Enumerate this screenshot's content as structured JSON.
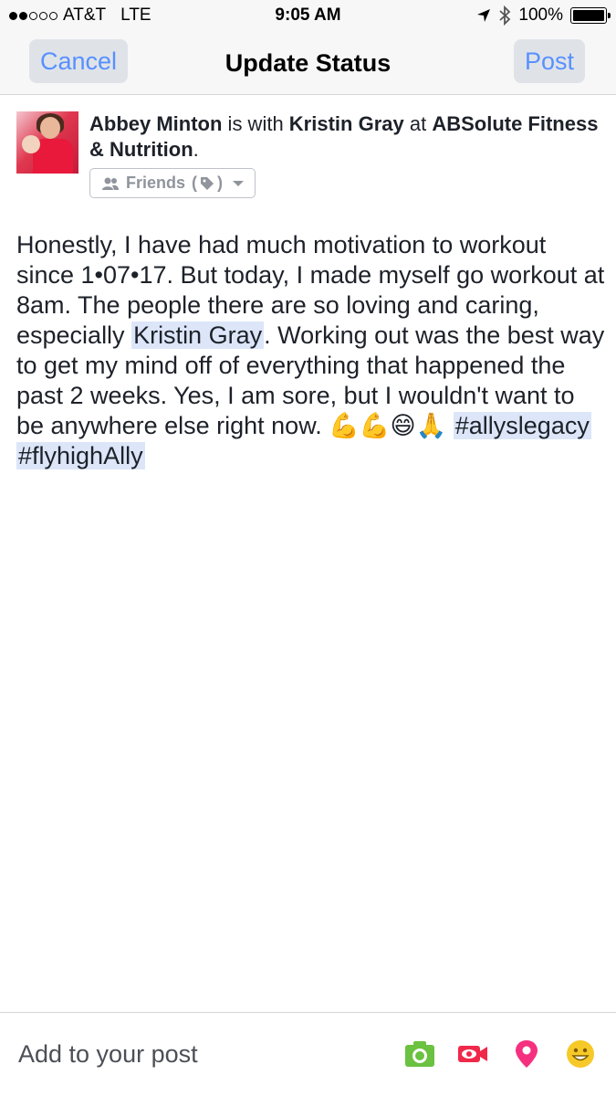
{
  "status_bar": {
    "carrier": "AT&T",
    "network": "LTE",
    "time": "9:05 AM",
    "battery": "100%",
    "signal_bars_filled": 2,
    "signal_bars_total": 5
  },
  "nav": {
    "cancel_label": "Cancel",
    "title": "Update Status",
    "post_label": "Post"
  },
  "header": {
    "author": "Abbey Minton",
    "with_text": " is with ",
    "tagged": "Kristin Gray",
    "at_text": " at ",
    "place": "ABSolute Fitness & Nutrition",
    "end": ".",
    "audience": "Friends",
    "audience_paren_open": "(",
    "audience_paren_close": ")"
  },
  "post": {
    "text_part1": "Honestly, I have had much motivation to workout since 1•07•17. But today, I made myself go workout at 8am. The people there are so loving and caring, especially ",
    "mention": "Kristin Gray",
    "text_part2": ". Working out was the best way to get my mind off of everything that happened the past 2 weeks. Yes, I am sore, but I wouldn't want to be anywhere else right now.",
    "emoji": "💪💪😄🙏",
    "hashtag1": "#allyslegacy",
    "hashtag2": "#flyhighAlly"
  },
  "bottom_bar": {
    "label": "Add to your post",
    "icons": [
      "camera-icon",
      "video-icon",
      "location-pin-icon",
      "smiley-icon"
    ]
  },
  "colors": {
    "accent_blue": "#5890ff",
    "highlight": "#dce6f8",
    "camera_green": "#6bc140",
    "video_red": "#f02849",
    "pin_pink": "#f5317f",
    "smiley_yellow": "#f7c928"
  }
}
